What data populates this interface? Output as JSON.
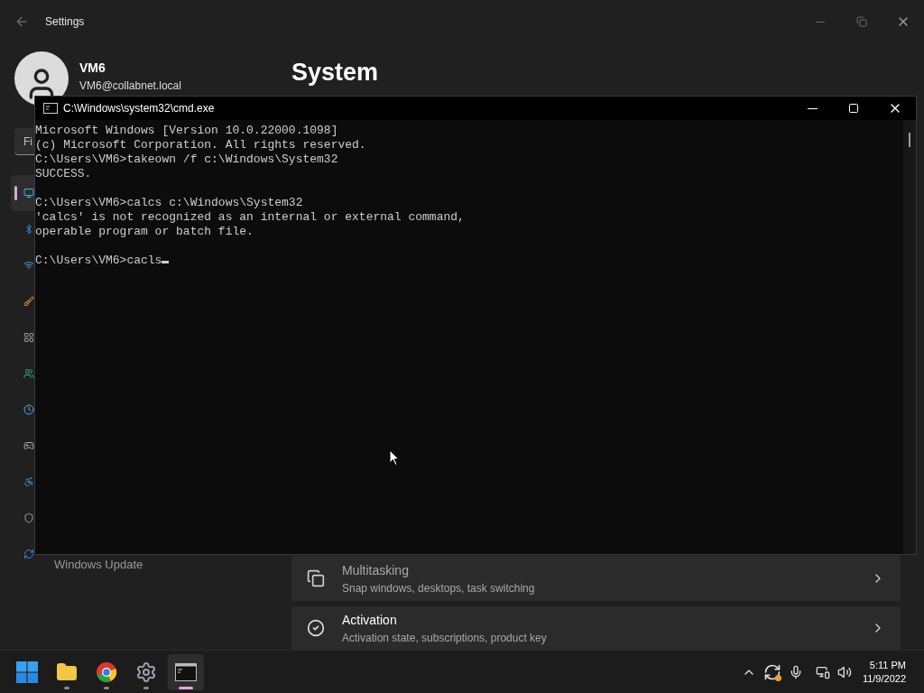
{
  "settings": {
    "title": "Settings",
    "user": {
      "name": "VM6",
      "email": "VM6@collabnet.local"
    },
    "search": {
      "placeholder": "Fi"
    },
    "heading": "System",
    "sidebar": {
      "items": [
        {
          "selected": true
        },
        {
          "selected": false
        },
        {
          "selected": false
        },
        {
          "selected": false
        },
        {
          "selected": false
        },
        {
          "selected": false
        },
        {
          "selected": false
        },
        {
          "selected": false
        },
        {
          "selected": false
        },
        {
          "selected": false
        },
        {
          "selected": false,
          "label": "Windows Update"
        }
      ]
    },
    "cards": [
      {
        "kind": "multitasking",
        "title": "Multitasking",
        "subtitle": "Snap windows, desktops, task switching"
      },
      {
        "kind": "activation",
        "title": "Activation",
        "subtitle": "Activation state, subscriptions, product key"
      }
    ]
  },
  "console": {
    "title": "C:\\Windows\\system32\\cmd.exe",
    "blocks": [
      [
        "Microsoft Windows [Version 10.0.22000.1098]",
        "(c) Microsoft Corporation. All rights reserved.",
        "C:\\Users\\VM6>takeown /f c:\\Windows\\System32",
        "SUCCESS."
      ],
      [
        "C:\\Users\\VM6>calcs c:\\Windows\\System32",
        "'calcs' is not recognized as an internal or external command,",
        "operable program or batch file."
      ],
      [
        "C:\\Users\\VM6>cacls"
      ]
    ]
  },
  "taskbar": {
    "apps": [
      {
        "kind": "start",
        "running": false,
        "selected": false
      },
      {
        "kind": "folder",
        "running": true,
        "selected": false
      },
      {
        "kind": "browser",
        "running": true,
        "selected": false
      },
      {
        "kind": "settings",
        "running": true,
        "selected": false
      },
      {
        "kind": "terminal",
        "running": true,
        "selected": true
      }
    ],
    "time": "5:11 PM",
    "date": "11/9/2022"
  }
}
